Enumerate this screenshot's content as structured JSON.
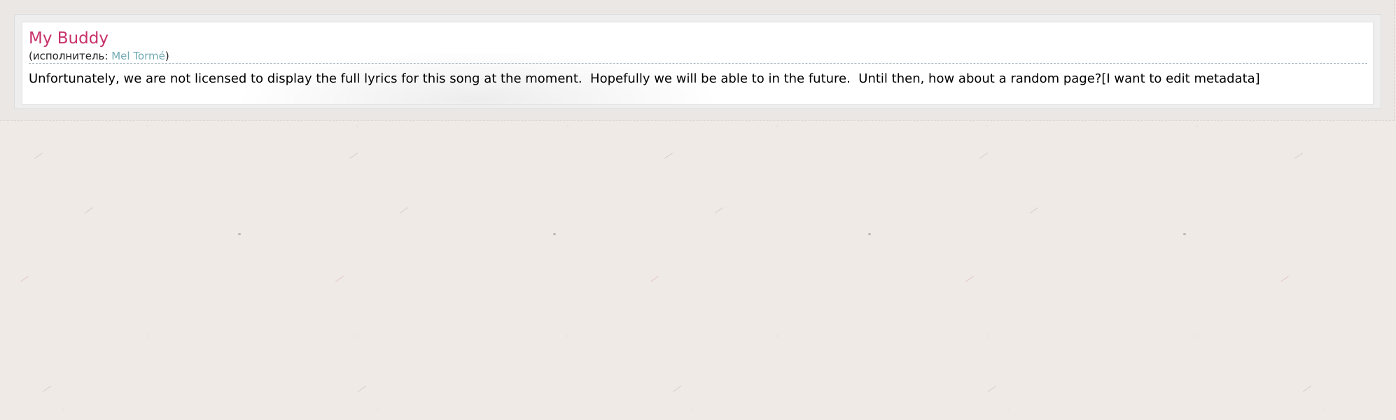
{
  "song": {
    "title": "My Buddy",
    "artist_prefix": "(исполнитель: ",
    "artist_name": "Mel Tormé",
    "artist_suffix": ")"
  },
  "notice": {
    "text": "Unfortunately, we are not licensed to display the full lyrics for this song at the moment.  Hopefully we will be able to in the future.  Until then, how about a random page?",
    "edit_link": "[I want to edit metadata]"
  },
  "colors": {
    "title": "#c8316a",
    "artist_link": "#72aab4",
    "background": "#efeae6"
  }
}
